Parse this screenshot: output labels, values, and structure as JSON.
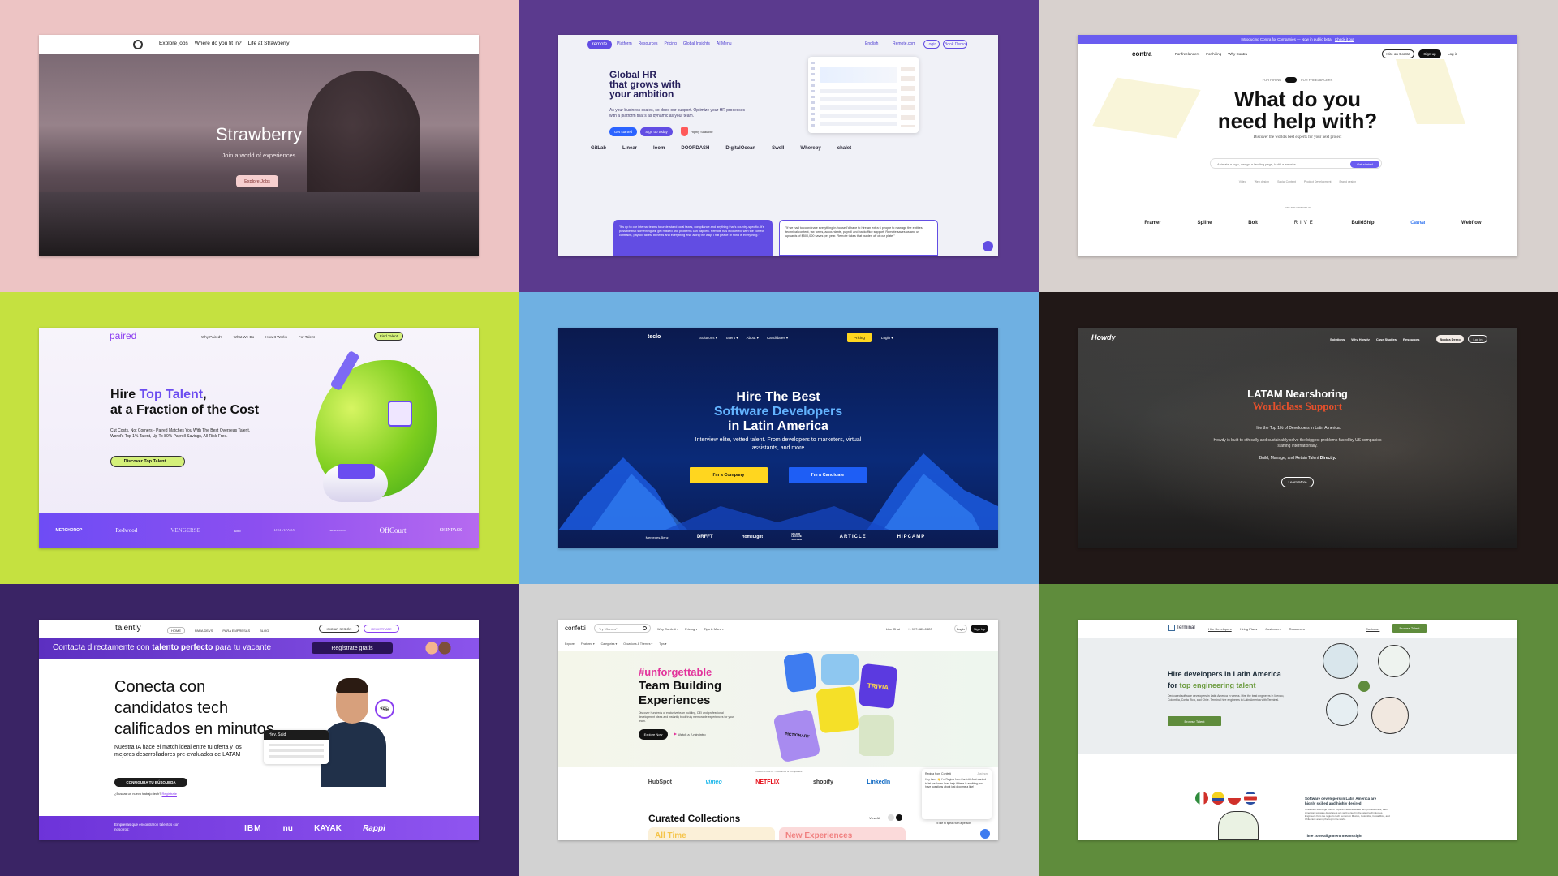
{
  "colors": {
    "bg_pink": "#edc4c4",
    "bg_purple": "#5b3a8e",
    "bg_beige": "#d8d1ce",
    "bg_lime": "#c5e140",
    "bg_sky": "#6fb0e2",
    "bg_dark": "#211817",
    "bg_indigo": "#3a2465",
    "bg_grey": "#d2d2d2",
    "bg_green": "#5f8c3c"
  },
  "strawberry": {
    "nav": [
      "Explore jobs",
      "Where do you fit in?",
      "Life at Strawberry"
    ],
    "title": "Strawberry",
    "subtitle": "Join a world of experiences",
    "cta": "Explore Jobs"
  },
  "remote": {
    "brand": "remote",
    "nav": [
      "Platform",
      "Resources",
      "Pricing",
      "Global Insights",
      "AI Menu"
    ],
    "lang": "English",
    "contact": "Remote.com",
    "login": "Login",
    "demo": "Book Demo",
    "headline": [
      "Global HR",
      "that grows with",
      "your ambition"
    ],
    "body": "As your business scales, so does our support. Optimize your HR processes with a platform that's as dynamic as your team.",
    "cta_primary": "Get started",
    "cta_secondary": "Sign up today",
    "badge": "Highly Scalable",
    "logos": [
      "GitLab",
      "Linear",
      "loom",
      "DOORDASH",
      "DigitalOcean",
      "Swell",
      "Whereby",
      "chalet"
    ],
    "quote1": "\"It's up to our internal teams to understand local taxes, compliance and anything that's country-specific. It's possible that something will get missed and problems can happen. Remote has it covered, with the correct contracts, payroll, taxes, benefits and everything else along the way. That peace of mind is everything.\"",
    "quote2": "\"If we had to coordinate everything in-house I'd have to hire an extra 6 people to manage the entities, technical content, tax forms, accountants, payroll and backoffice support. Remote saves us and us upwards of $500,000 saves per year. Remote takes that burden off of our plate.\""
  },
  "contra": {
    "banner": "Introducing Contra for Companies — Now in public beta.",
    "banner_link": "Check it out",
    "brand": "contra",
    "nav": [
      "For freelancers",
      "For hiring",
      "Why Contra"
    ],
    "hire": "Hire on Contra",
    "signup": "Sign up",
    "login": "Log in",
    "toggle_left": "FOR HIRING",
    "toggle_right": "FOR FREELANCERS",
    "headline": [
      "What do you",
      "need help with?"
    ],
    "sub": "Discover the world's best experts for your next project",
    "search_placeholder": "Animate a logo, design a landing page, build a website...",
    "search_btn": "Get started",
    "chips": [
      "Video",
      "Web design",
      "Social Content",
      "Product Development",
      "Brand design"
    ],
    "trusted": "Hire the experts in",
    "logos": [
      "Framer",
      "Spline",
      "Bolt",
      "RIVE",
      "BuildShip",
      "Canva",
      "Webflow"
    ]
  },
  "paired": {
    "brand": "paired",
    "nav": [
      "Why Paired?",
      "What We Do",
      "How It Works",
      "For Talent"
    ],
    "cta_nav": "Find Talent",
    "headline_1a": "Hire ",
    "headline_1b": "Top Talent",
    "headline_1c": ",",
    "headline_2": "at a Fraction of the Cost",
    "body": "Cut Costs, Not Corners - Paired Matches You With The Best Overseas Talent. World's Top 1% Talent, Up To 80% Payroll Savings, All Risk-Free.",
    "cta": "Discover Top Talent →",
    "logos": [
      "MERCHDROP",
      "Redwood",
      "VENGERSE",
      "Bobo",
      "DRIVEWAY",
      "PRINCELONS",
      "OffCourt",
      "SKINPASS"
    ]
  },
  "teclo": {
    "brand": "teclo",
    "nav": [
      "Solutions ▾",
      "Talent ▾",
      "About ▾",
      "Candidates ▾"
    ],
    "pricing": "Pricing",
    "login": "Login ▾",
    "headline_1": "Hire The Best",
    "headline_2": "Software Developers",
    "headline_3": "in Latin America",
    "body": "Interview elite, vetted talent. From developers to marketers, virtual assistants, and more",
    "cta_company": "I'm a Company",
    "cta_candidate": "I'm a Candidate",
    "logos": [
      "Mercedes-Benz",
      "DRFFT",
      "HomeLight",
      "MAJOR LEAGUE SOCCER",
      "ARTICLE.",
      "HIPCAMP"
    ]
  },
  "howdy": {
    "brand": "Howdy",
    "nav": [
      "Solutions",
      "Why Howdy",
      "Case Studies",
      "Resources"
    ],
    "demo": "Book a Demo",
    "login": "Log in",
    "headline_1": "LATAM Nearshoring",
    "headline_2": "Worldclass Support",
    "line1": "Hire the Top 1% of Developers in Latin America.",
    "line2": "Howdy is built to ethically and sustainably solve the biggest problems faced by US companies staffing internationally.",
    "line3a": "Build, Manage, and Retain Talent ",
    "line3b": "Directly.",
    "cta": "Learn More"
  },
  "talently": {
    "brand": "talently",
    "nav": [
      "HOME",
      "PARA DEVS",
      "PARA EMPRESAS",
      "BLOG"
    ],
    "login": "INICIAR SESIÓN",
    "register": "REGISTRATE",
    "banner_a": "Contacta directamente con ",
    "banner_b": "talento perfecto",
    "banner_c": " para tu vacante",
    "banner_btn": "Regístrate gratis",
    "headline": [
      "Conecta con",
      "candidatos tech",
      "calificados en minutos"
    ],
    "body": "Nuestra IA hace el match ideal entre tu oferta y los mejores desarrolladores pre-evaluados de LATAM",
    "cta": "CONFIGURA TU BÚSQUEDA",
    "link_a": "¿Buscas un nuevo trabajo tech?",
    "link_b": "Regístrate",
    "card_hello": "Hey, Said",
    "match": "75%",
    "match_label": "Match",
    "footer_text": "Empresas que encontraron talentos con nosotros:",
    "logos": [
      "IBM",
      "nu",
      "KAYAK",
      "Rappi"
    ]
  },
  "confetti": {
    "brand": "confetti",
    "search_placeholder": "Try \"Games\"",
    "nav": [
      "Why Confetti ▾",
      "Pricing ▾",
      "Tips & More ▾"
    ],
    "chat": "Live Chat",
    "phone": "+1 917-383-0320",
    "login": "Login",
    "signup": "Sign Up",
    "filters": [
      "Explore",
      "Featured ▾",
      "Categories ▾",
      "Occasions & Themes ▾",
      "Tips ▾"
    ],
    "tag": "#unforgettable",
    "headline": [
      "Team Building",
      "Experiences"
    ],
    "body": "Discover hundreds of exclusive team building, DEI and professional development ideas and instantly book truly memorable experiences for your team.",
    "cta": "Explore Now",
    "video": "Watch a 2-min intro",
    "cards": [
      "TRIVIA",
      "PICTIONARY"
    ],
    "trusted": "Trusted across by Thousands of Companies",
    "logos": [
      "HubSpot",
      "vimeo",
      "NETFLIX",
      "shopify",
      "LinkedIn"
    ],
    "section": "Curated Collections",
    "view_all": "View All",
    "tabs": [
      "All Time",
      "New Experiences"
    ],
    "chat_name": "Regina from Confetti",
    "chat_time": "Just now",
    "chat_msg": "Hey there 👋 I'm Regina from Confetti. Just wanted to let you know I can help if there is anything you have questions about just drop me a line!",
    "chat_link": "I'd like to speak with a person"
  },
  "terminal": {
    "brand": "Terminal",
    "nav": [
      "Hire Developers",
      "Hiring Plans",
      "Customers",
      "Resources"
    ],
    "login": "Customer",
    "cta_nav": "Browse Talent",
    "headline_1": "Hire developers in Latin America",
    "headline_2a": "for ",
    "headline_2b": "top engineering talent",
    "body": "Dedicated software developers in Latin America in weeks. Hire the best engineers in Mexico, Colombia, Costa Rica, and Chile. Terminal hire engineers in Latin America with Terminal.",
    "cta": "Browse Talent",
    "section_title": "Software developers in Latin America are highly skilled and highly desired",
    "section_body": "In addition to a large pool of experienced and skilled tech professionals, Latin American software developers are well-versed in the latest technologies. Engineers from the region's tech centers in Mexico, Colombia, Costa Rica, and Chile rank among the top in the world.",
    "section_next": "Time zone alignment means tight"
  }
}
